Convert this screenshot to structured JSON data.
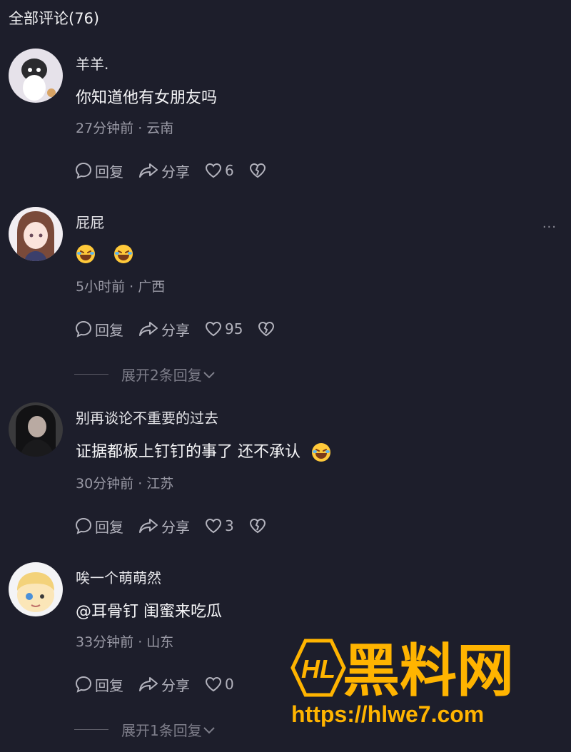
{
  "header": {
    "title": "全部评论(76)"
  },
  "labels": {
    "reply": "回复",
    "share": "分享"
  },
  "comments": [
    {
      "username": "羊羊.",
      "text": "你知道他有女朋友吗",
      "meta": "27分钟前 · 云南",
      "likes": "6"
    },
    {
      "username": "屁屁",
      "text": "",
      "emoji_count": 2,
      "meta": "5小时前 · 广西",
      "likes": "95",
      "expand": "展开2条回复",
      "more": "···"
    },
    {
      "username": "别再谈论不重要的过去",
      "text": "证据都板上钉钉的事了 还不承认",
      "meta": "30分钟前 · 江苏",
      "likes": "3"
    },
    {
      "username": "唉一个萌萌然",
      "text": "@耳骨钉  闺蜜来吃瓜",
      "meta": "33分钟前 · 山东",
      "likes": "0",
      "expand": "展开1条回复"
    }
  ],
  "watermark": {
    "logo": "HL",
    "name": "黑料网",
    "url": "https://hlwe7.com"
  },
  "colors": {
    "background": "#1d1e2b",
    "watermark": "#ffb400"
  }
}
